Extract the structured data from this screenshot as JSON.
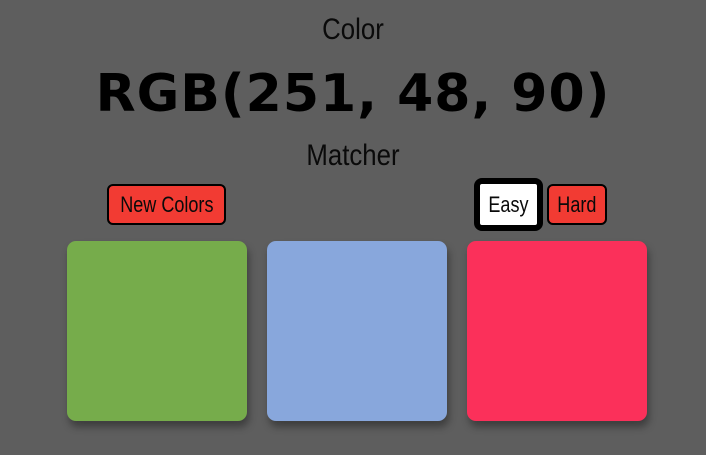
{
  "header": {
    "line1": "Color",
    "rgb_text": "RGB(251, 48, 90)",
    "line3": "Matcher"
  },
  "controls": {
    "new_colors_label": "New Colors",
    "easy_label": "Easy",
    "hard_label": "Hard",
    "selected_mode": "Easy",
    "accent_color": "#f23b33"
  },
  "swatches": [
    {
      "color": "#76ac4b"
    },
    {
      "color": "#88a7dc"
    },
    {
      "color": "#fb305a"
    }
  ],
  "colors": {
    "background": "#5e5e5e"
  }
}
